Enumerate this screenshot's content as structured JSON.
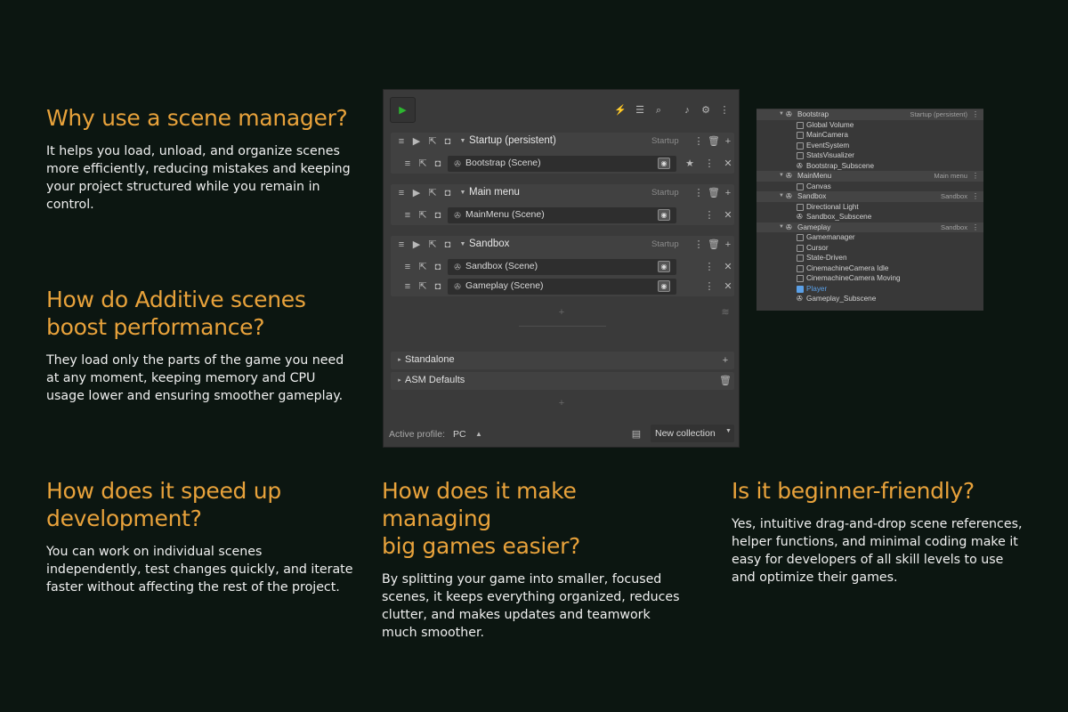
{
  "faq": {
    "q1": {
      "title": "Why use a scene manager?",
      "body": "It helps you load, unload, and organize scenes more efficiently, reducing mistakes and keeping your project structured while you remain in control."
    },
    "q2": {
      "title_line1": "How do Additive scenes",
      "title_line2": "boost performance?",
      "body": "They load only the parts of the game you need at any moment, keeping memory and CPU usage lower and ensuring smoother gameplay."
    },
    "q3": {
      "title_line1": "How does it speed up",
      "title_line2": "development?",
      "body": "You can work on individual scenes independently, test changes quickly, and iterate faster without affecting the rest of the project."
    },
    "q4": {
      "title_line1": "How does it make managing",
      "title_line2": "big games easier?",
      "body": "By splitting your game into smaller, focused scenes, it keeps everything organized, reduces clutter, and makes updates and teamwork much smoother."
    },
    "q5": {
      "title": "Is it beginner-friendly?",
      "body": "Yes, intuitive drag-and-drop scene references, helper functions, and minimal coding make it easy for developers of all skill levels to use and optimize their games."
    }
  },
  "scene_manager": {
    "collections": [
      {
        "title": "Startup (persistent)",
        "tag": "Startup",
        "scenes": [
          {
            "name": "Bootstrap (Scene)",
            "starred": true
          }
        ]
      },
      {
        "title": "Main menu",
        "tag": "Startup",
        "scenes": [
          {
            "name": "MainMenu (Scene)",
            "starred": false
          }
        ]
      },
      {
        "title": "Sandbox",
        "tag": "Startup",
        "scenes": [
          {
            "name": "Sandbox (Scene)",
            "starred": false
          },
          {
            "name": "Gameplay (Scene)",
            "starred": false
          }
        ]
      }
    ],
    "standalone_label": "Standalone",
    "asm_defaults_label": "ASM Defaults",
    "active_profile_label": "Active profile:",
    "active_profile_value": "PC",
    "new_collection_label": "New collection",
    "accent_color": "#2db530"
  },
  "hierarchy": {
    "rows": [
      {
        "name": "Bootstrap",
        "tag": "Startup (persistent)",
        "header": true
      },
      {
        "name": "Global Volume"
      },
      {
        "name": "MainCamera"
      },
      {
        "name": "EventSystem"
      },
      {
        "name": "StatsVisualizer"
      },
      {
        "name": "Bootstrap_Subscene"
      },
      {
        "name": "MainMenu",
        "tag": "Main menu",
        "header": true
      },
      {
        "name": "Canvas"
      },
      {
        "name": "Sandbox",
        "tag": "Sandbox",
        "header": true
      },
      {
        "name": "Directional Light"
      },
      {
        "name": "Sandbox_Subscene"
      },
      {
        "name": "Gameplay",
        "tag": "Sandbox",
        "header": true
      },
      {
        "name": "Gamemanager"
      },
      {
        "name": "Cursor"
      },
      {
        "name": "State-Driven"
      },
      {
        "name": "CinemachineCamera Idle"
      },
      {
        "name": "CinemachineCamera Moving"
      },
      {
        "name": "Player",
        "highlight_color": "#5aa0e8"
      },
      {
        "name": "Gameplay_Subscene"
      }
    ]
  }
}
